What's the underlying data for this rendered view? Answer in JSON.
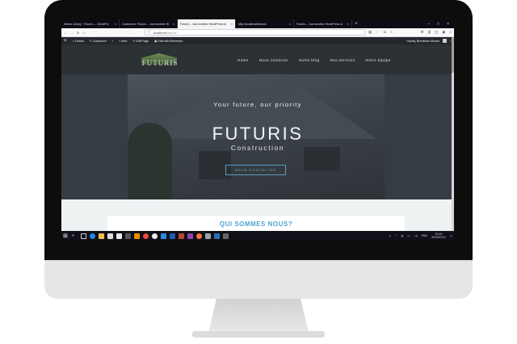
{
  "browser": {
    "tabs": [
      {
        "label": "Media Library ‹ Futuris — WordPre",
        "active": false
      },
      {
        "label": "Customize: Futuris – Just another W",
        "active": false
      },
      {
        "label": "Futuris – Just another WordPress si",
        "active": true
      },
      {
        "label": "http://localhost/futuris/",
        "active": false
      },
      {
        "label": "Futuris – Just another WordPress si",
        "active": false
      }
    ],
    "new_tab": "+",
    "window_controls": [
      "–",
      "□",
      "×"
    ],
    "url_host": "localhost",
    "url_path": "/futuris/"
  },
  "wp_admin_bar": {
    "site_name": "Futuris",
    "customize": "Customize",
    "new": "New",
    "edit_page": "Edit Page",
    "edit_elementor": "Edit with Elementor",
    "howdy": "Howdy, Brenswen Mourie"
  },
  "site": {
    "logo_text": "FUTURIS",
    "menu": [
      "Home",
      "Nous contacter",
      "Notre blog",
      "Nos services",
      "Notre équipe"
    ],
    "tagline": "Your future, our priority",
    "brand": "FUTURIS",
    "sub": "Construction",
    "cta": "NOUS CONTACTER",
    "section_title": "QUI SOMMES NOUS?"
  },
  "taskbar": {
    "lang": "ENG",
    "time": "22:29",
    "date": "2019/07/13"
  },
  "colors": {
    "accent": "#4fa3d1",
    "header_bg": "#2c3136",
    "wp_bar": "#23282d"
  }
}
